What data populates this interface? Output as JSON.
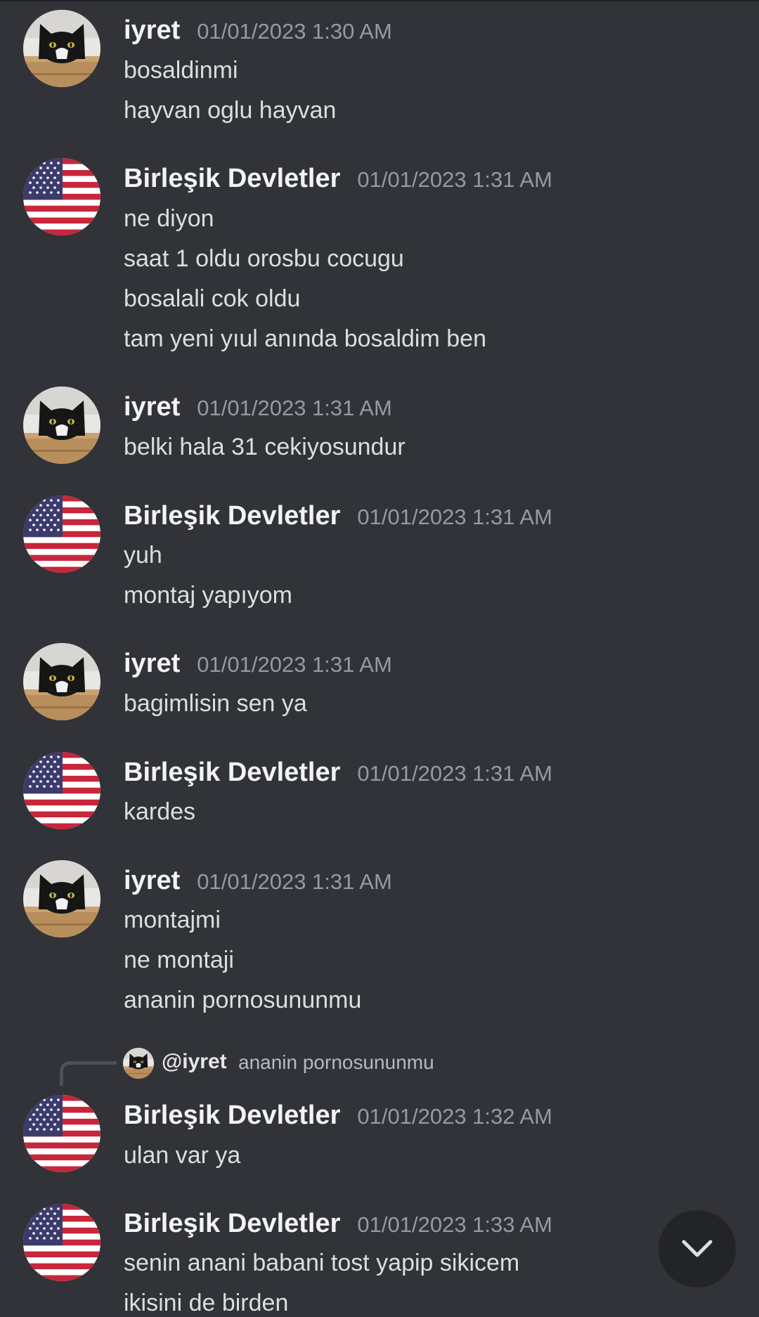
{
  "colors": {
    "background": "#313338",
    "username": "#f2f3f5",
    "timestamp": "#949ba4",
    "message_text": "#dbdee1",
    "jump_button": "#232428"
  },
  "messages": [
    {
      "author": "iyret",
      "avatar": "cat-avatar",
      "timestamp": "01/01/2023 1:30 AM",
      "lines": [
        "bosaldinmi",
        "hayvan oglu hayvan"
      ]
    },
    {
      "author": "Birleşik Devletler",
      "avatar": "us-flag-avatar",
      "timestamp": "01/01/2023 1:31 AM",
      "lines": [
        "ne diyon",
        "saat 1 oldu orosbu cocugu",
        "bosalali cok oldu",
        "tam yeni yıul anında bosaldim ben"
      ]
    },
    {
      "author": "iyret",
      "avatar": "cat-avatar",
      "timestamp": "01/01/2023 1:31 AM",
      "lines": [
        "belki hala 31 cekiyosundur"
      ]
    },
    {
      "author": "Birleşik Devletler",
      "avatar": "us-flag-avatar",
      "timestamp": "01/01/2023 1:31 AM",
      "lines": [
        "yuh",
        "montaj yapıyom"
      ]
    },
    {
      "author": "iyret",
      "avatar": "cat-avatar",
      "timestamp": "01/01/2023 1:31 AM",
      "lines": [
        "bagimlisin sen ya"
      ]
    },
    {
      "author": "Birleşik Devletler",
      "avatar": "us-flag-avatar",
      "timestamp": "01/01/2023 1:31 AM",
      "lines": [
        "kardes"
      ]
    },
    {
      "author": "iyret",
      "avatar": "cat-avatar",
      "timestamp": "01/01/2023 1:31 AM",
      "lines": [
        "montajmi",
        "ne montaji",
        "ananin pornosununmu"
      ]
    },
    {
      "author": "Birleşik Devletler",
      "avatar": "us-flag-avatar",
      "timestamp": "01/01/2023 1:32 AM",
      "lines": [
        "ulan var ya"
      ],
      "reply": {
        "mention": "@iyret",
        "text": "ananin pornosununmu"
      }
    },
    {
      "author": "Birleşik Devletler",
      "avatar": "us-flag-avatar",
      "timestamp": "01/01/2023 1:33 AM",
      "lines": [
        "senin anani babani tost yapip sikicem",
        "ikisini de birden"
      ]
    }
  ],
  "jump_button": {
    "icon": "chevron-down-icon"
  }
}
